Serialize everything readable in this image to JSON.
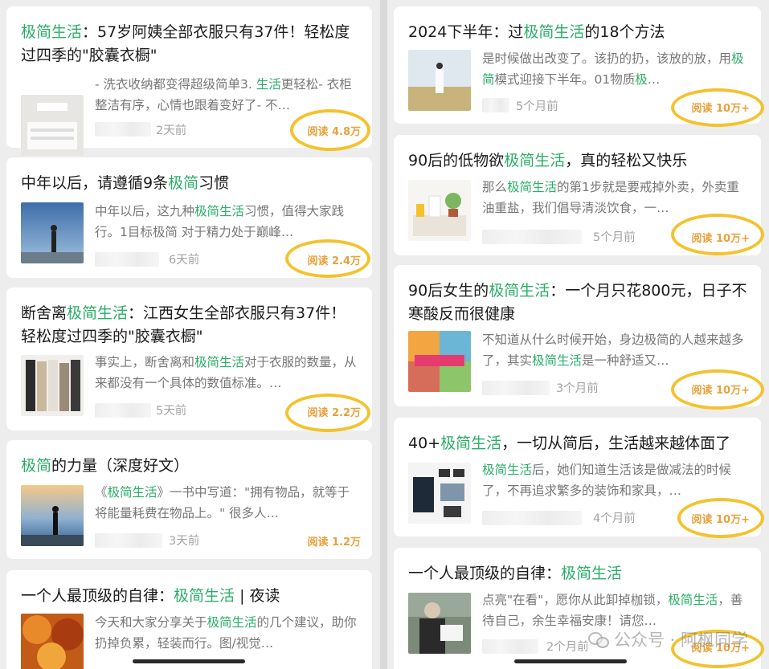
{
  "left": {
    "cards": [
      {
        "title_parts": [
          [
            "极简生活",
            true
          ],
          [
            "：57岁阿姨全部衣服只有37件！轻松度过四季的\"胶囊衣橱\"",
            false
          ]
        ],
        "summary_parts": [
          [
            "- 洗衣收纳都变得超级简单3. ",
            false
          ],
          [
            "生活",
            true
          ],
          [
            "更轻松- 衣柜整洁有序，心情也跟着变好了- 不…",
            false
          ]
        ],
        "time": "2天前",
        "reads": "阅读 4.8万",
        "thumb": "clothes"
      },
      {
        "title_parts": [
          [
            "中年以后，请遵循9条",
            false
          ],
          [
            "极简",
            true
          ],
          [
            "习惯",
            false
          ]
        ],
        "summary_parts": [
          [
            "中年以后，这九种",
            false
          ],
          [
            "极简生活",
            true
          ],
          [
            "习惯，值得大家践行。1目标极简 对于精力处于巅峰…",
            false
          ]
        ],
        "time": "6天前",
        "reads": "阅读 2.4万",
        "thumb": "sky"
      },
      {
        "title_parts": [
          [
            "断舍离",
            false
          ],
          [
            "极简生活",
            true
          ],
          [
            "：江西女生全部衣服只有37件！轻松度过四季的\"胶囊衣橱\"",
            false
          ]
        ],
        "summary_parts": [
          [
            "事实上，断舍离和",
            false
          ],
          [
            "极简生活",
            true
          ],
          [
            "对于衣服的数量，从来都没有一个具体的数值标准。…",
            false
          ]
        ],
        "time": "5天前",
        "reads": "阅读 2.2万",
        "thumb": "wardrobe"
      },
      {
        "title_parts": [
          [
            "极简",
            true
          ],
          [
            "的力量（深度好文）",
            false
          ]
        ],
        "summary_parts": [
          [
            "《",
            false
          ],
          [
            "极简生活",
            true
          ],
          [
            "》一书中写道：\"拥有物品，就等于将能量耗费在物品上。\" 很多人…",
            false
          ]
        ],
        "time": "3天前",
        "reads": "阅读 1.2万",
        "thumb": "sea"
      },
      {
        "title_parts": [
          [
            "一个人最顶级的自律：",
            false
          ],
          [
            "极简生活",
            true
          ],
          [
            " | 夜读",
            false
          ]
        ],
        "summary_parts": [
          [
            "今天和大家分享关于",
            false
          ],
          [
            "极简生活",
            true
          ],
          [
            "的几个建议，助你扔掉负累，轻装而行。图/视觉…",
            false
          ]
        ],
        "time": "",
        "reads": "",
        "thumb": "autumn"
      }
    ]
  },
  "right": {
    "cards": [
      {
        "title_parts": [
          [
            "2024下半年：过",
            false
          ],
          [
            "极简生活",
            true
          ],
          [
            "的18个方法",
            false
          ]
        ],
        "summary_parts": [
          [
            "是时候做出改变了。该扔的扔，该放的放，用",
            false
          ],
          [
            "极简",
            true
          ],
          [
            "模式迎接下半年。01物质",
            false
          ],
          [
            "极",
            true
          ],
          [
            "…",
            false
          ]
        ],
        "time": "5个月前",
        "reads": "阅读 10万+",
        "thumb": "field"
      },
      {
        "title_parts": [
          [
            "90后的低物欲",
            false
          ],
          [
            "极简生活",
            true
          ],
          [
            "，真的轻松又快乐",
            false
          ]
        ],
        "summary_parts": [
          [
            "那么",
            false
          ],
          [
            "极简生活",
            true
          ],
          [
            "的第1步就是要戒掉外卖，外卖重油重盐，我们倡导清淡饮食，一…",
            false
          ]
        ],
        "time": "5个月前",
        "reads": "阅读 10万+",
        "thumb": "kitchen"
      },
      {
        "title_parts": [
          [
            "90后女生的",
            false
          ],
          [
            "极简生活",
            true
          ],
          [
            "：一个月只花800元，日子不寒酸反而很健康",
            false
          ]
        ],
        "summary_parts": [
          [
            "不知道从什么时候开始，身边极简的人越来越多了，其实",
            false
          ],
          [
            "极简生活",
            true
          ],
          [
            "是一种舒适又…",
            false
          ]
        ],
        "time": "3个月前",
        "reads": "阅读 10万+",
        "thumb": "food"
      },
      {
        "title_parts": [
          [
            "40+",
            false
          ],
          [
            "极简生活",
            true
          ],
          [
            "，一切从简后，生活越来越体面了",
            false
          ]
        ],
        "summary_parts": [
          [
            "极简生活",
            true
          ],
          [
            "后，她们知道生活该是做减法的时候了，不再追求繁多的装饰和家具，…",
            false
          ]
        ],
        "time": "4个月前",
        "reads": "阅读 10万+",
        "thumb": "outfit"
      },
      {
        "title_parts": [
          [
            "一个人最顶级的自律：",
            false
          ],
          [
            "极简生活",
            true
          ]
        ],
        "summary_parts": [
          [
            "点亮\"在看\"，愿你从此卸掉枷锁，",
            false
          ],
          [
            "极简生活",
            true
          ],
          [
            "，善待自己，余生幸福安康！请您…",
            false
          ]
        ],
        "time": "2个月前",
        "reads": "阅读 10万+",
        "thumb": "elder"
      }
    ]
  },
  "watermark": "公众号 · 阿枫同学",
  "colors": {
    "highlight": "#2aae67",
    "reads": "#e6a23c",
    "circle": "#f3c22d"
  }
}
